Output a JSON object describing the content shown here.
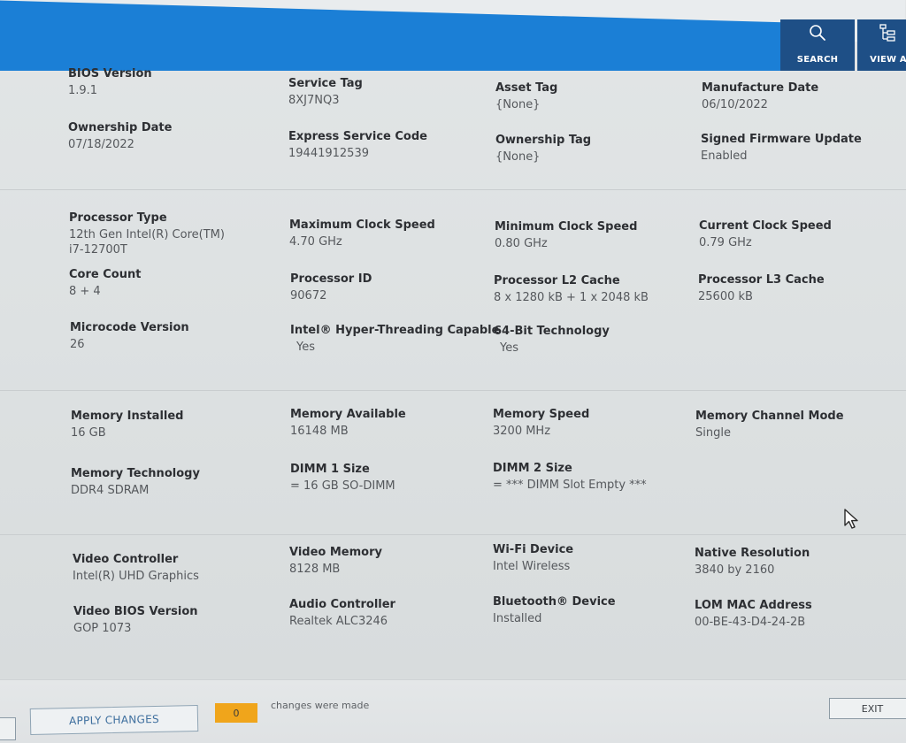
{
  "header": {
    "search_label": "SEARCH",
    "view_label": "VIEW A",
    "search_icon": "search-icon",
    "view_icon": "view-all-icon",
    "accent_color": "#1b7fd6"
  },
  "system": {
    "bios_version": {
      "label": "BIOS Version",
      "value": "1.9.1"
    },
    "service_tag": {
      "label": "Service Tag",
      "value": "8XJ7NQ3"
    },
    "asset_tag": {
      "label": "Asset Tag",
      "value": "{None}"
    },
    "manufacture_date": {
      "label": "Manufacture Date",
      "value": "06/10/2022"
    },
    "ownership_date": {
      "label": "Ownership Date",
      "value": "07/18/2022"
    },
    "express_service_code": {
      "label": "Express Service Code",
      "value": "19441912539"
    },
    "ownership_tag": {
      "label": "Ownership Tag",
      "value": "{None}"
    },
    "signed_firmware_update": {
      "label": "Signed Firmware Update",
      "value": "Enabled"
    }
  },
  "processor": {
    "type": {
      "label": "Processor Type",
      "value_line1": "12th Gen Intel(R) Core(TM)",
      "value_line2": "i7-12700T"
    },
    "max_clock": {
      "label": "Maximum Clock Speed",
      "value": "4.70 GHz"
    },
    "min_clock": {
      "label": "Minimum Clock Speed",
      "value": "0.80 GHz"
    },
    "current_clock": {
      "label": "Current Clock Speed",
      "value": "0.79 GHz"
    },
    "core_count": {
      "label": "Core Count",
      "value": "8 + 4"
    },
    "processor_id": {
      "label": "Processor ID",
      "value": "90672"
    },
    "l2_cache": {
      "label": "Processor L2 Cache",
      "value": "8 x 1280  kB + 1 x 2048  kB"
    },
    "l3_cache": {
      "label": "Processor L3 Cache",
      "value": "25600 kB"
    },
    "microcode": {
      "label": "Microcode Version",
      "value": "26"
    },
    "hyperthreading": {
      "label": "Intel® Hyper-Threading Capable",
      "value": "Yes"
    },
    "bit64": {
      "label": "64-Bit Technology",
      "value": "Yes"
    }
  },
  "memory": {
    "installed": {
      "label": "Memory Installed",
      "value": "16 GB"
    },
    "available": {
      "label": "Memory Available",
      "value": "16148 MB"
    },
    "speed": {
      "label": "Memory Speed",
      "value": "3200 MHz"
    },
    "channel_mode": {
      "label": "Memory Channel Mode",
      "value": "Single"
    },
    "technology": {
      "label": "Memory Technology",
      "value": "DDR4 SDRAM"
    },
    "dimm1": {
      "label": "DIMM 1 Size",
      "value": "= 16 GB SO-DIMM"
    },
    "dimm2": {
      "label": "DIMM 2 Size",
      "value": "= *** DIMM Slot Empty ***"
    }
  },
  "devices": {
    "video_controller": {
      "label": "Video Controller",
      "value": "Intel(R) UHD Graphics"
    },
    "video_memory": {
      "label": "Video Memory",
      "value": "8128 MB"
    },
    "wifi": {
      "label": "Wi-Fi Device",
      "value": "Intel Wireless"
    },
    "native_resolution": {
      "label": "Native Resolution",
      "value": "3840 by 2160"
    },
    "video_bios": {
      "label": "Video BIOS Version",
      "value": "GOP 1073"
    },
    "audio": {
      "label": "Audio Controller",
      "value": "Realtek ALC3246"
    },
    "bluetooth": {
      "label": "Bluetooth® Device",
      "value": "Installed"
    },
    "lom_mac": {
      "label": "LOM MAC Address",
      "value": "00-BE-43-D4-24-2B"
    }
  },
  "footer": {
    "apply_label": "APPLY CHANGES",
    "change_count": "0",
    "changes_text": "changes were made",
    "exit_label": "EXIT",
    "count_badge_color": "#f0a51b"
  }
}
